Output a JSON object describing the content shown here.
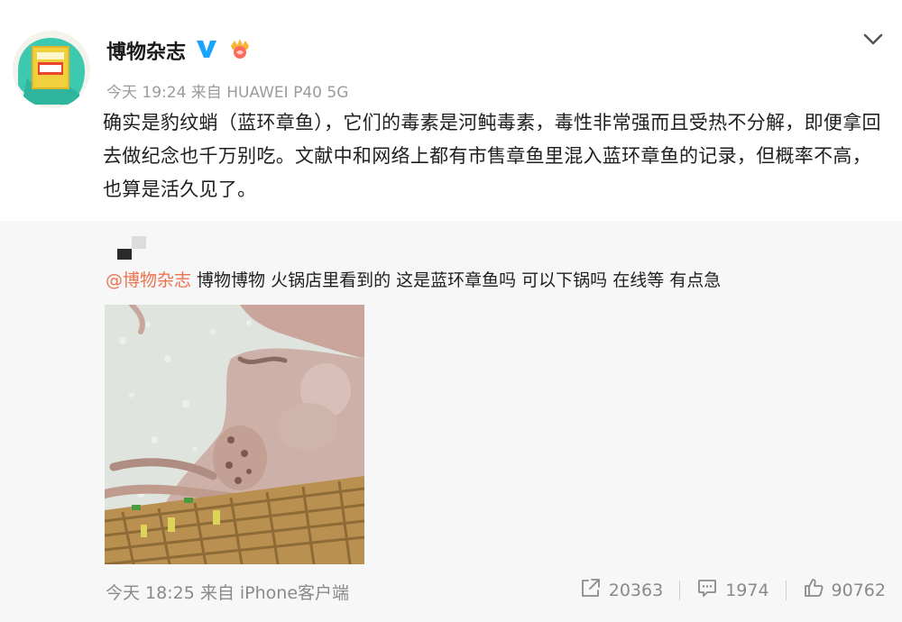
{
  "author": {
    "name": "博物杂志",
    "avatar_icon": "magazine-avatar-icon",
    "verified_icon": "verified-v-icon",
    "member_icon": "crown-member-icon"
  },
  "post": {
    "time_meta": "今天 19:24 来自 HUAWEI P40 5G",
    "text": "确实是豹纹蛸（蓝环章鱼），它们的毒素是河鲀毒素，毒性非常强而且受热不分解，即便拿回去做纪念也千万别吃。文献中和网络上都有市售章鱼里混入蓝环章鱼的记录，但概率不高，也算是活久见了。"
  },
  "quoted": {
    "mention": "@博物杂志",
    "text": " 博物博物 火锅店里看到的 这是蓝环章鱼吗 可以下锅吗 在线等 有点急",
    "time_meta": "今天 18:25 来自 iPhone客户端",
    "image_icon": "octopus-basket-photo"
  },
  "actions": {
    "repost_count": "20363",
    "comment_count": "1974",
    "like_count": "90762"
  },
  "colors": {
    "mention": "#eb7350",
    "meta": "#9b9b9b",
    "verified": "#1aa3ff",
    "quote_bg": "#f7f7f7"
  }
}
